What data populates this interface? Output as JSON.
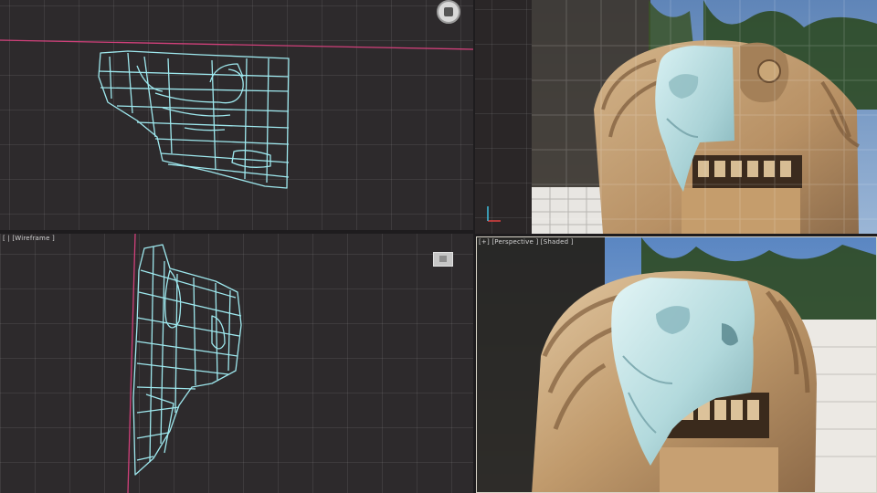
{
  "viewports": {
    "top_left": {
      "label": ""
    },
    "bottom_left": {
      "label": "[ | [Wireframe ]"
    },
    "top_right": {
      "label": ""
    },
    "bottom_right": {
      "label": "[+] [Perspective ] [Shaded ]"
    }
  },
  "colors": {
    "wireframe": "#9ee8ee",
    "active_axis_line": "#d0407a",
    "viewport_border": "#d8d4c8",
    "mesh_shaded": "#b8dde0",
    "stone": "#c7a57a"
  },
  "icons": [
    "viewcube-home-icon",
    "viewport-shading-icon",
    "axis-tripod-icon"
  ]
}
